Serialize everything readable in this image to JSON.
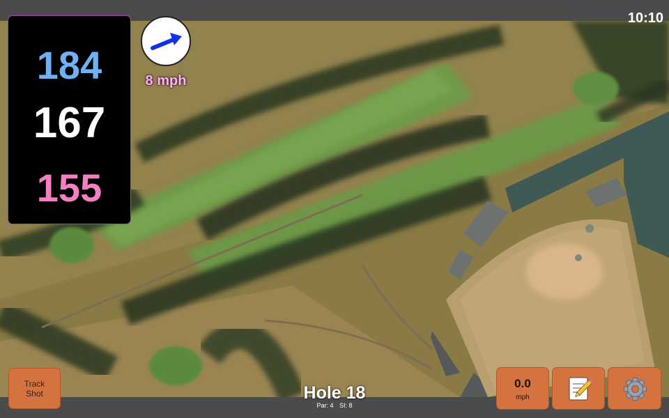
{
  "status_bar": {
    "time": "10:10"
  },
  "distances": {
    "back": "184",
    "middle": "167",
    "front": "155"
  },
  "wind": {
    "speed_label": "8 mph",
    "icon": "arrow-icon",
    "arrow_color": "#1430e6"
  },
  "buttons": {
    "track_shot_line1": "Track",
    "track_shot_line2": "Shot",
    "speed_value": "0.0",
    "speed_unit": "mph",
    "notes_icon": "notepad-icon",
    "settings_icon": "gear-icon"
  },
  "hole": {
    "title": "Hole 18",
    "par_label": "Par: 4",
    "si_label": "SI: 8"
  },
  "colors": {
    "back_distance": "#6fb1f2",
    "middle_distance": "#ffffff",
    "front_distance": "#f57fc2",
    "button": "#d4733f"
  }
}
